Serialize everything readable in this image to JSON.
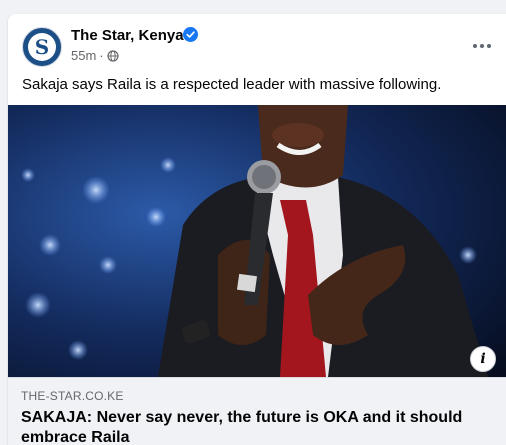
{
  "post": {
    "page_name": "The Star, Kenya",
    "avatar_letter": "S",
    "time": "55m",
    "separator": "·",
    "text": "Sakaja says Raila is a respected leader with massive following."
  },
  "link": {
    "domain": "THE-STAR.CO.KE",
    "title": "SAKAJA: Never say never, the future is OKA and it should embrace Raila"
  },
  "image": {
    "info_label": "i"
  },
  "icons": {
    "verified": "verified-badge-icon",
    "audience": "globe-icon",
    "more": "more-options-icon",
    "info": "info-icon"
  },
  "colors": {
    "verified": "#1877f2",
    "brand": "#1d4f87",
    "secondary_text": "#65676b"
  }
}
